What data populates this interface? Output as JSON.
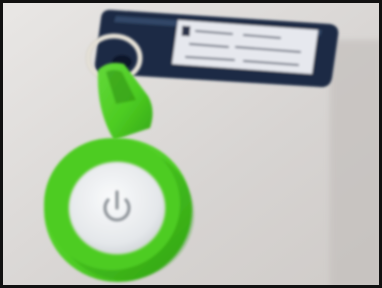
{
  "photo": {
    "subject_icon": "power-icon",
    "colors": {
      "frame_border": "#111111",
      "background_table": "#d9d7d5",
      "fob_green": "#4dcc22",
      "fob_green_dark": "#2f9e15",
      "button_white": "#e9ecef",
      "tag_navy": "#1b2a44",
      "key_ring": "#c9c6c0",
      "label_paper": "#e6e8ee"
    }
  }
}
